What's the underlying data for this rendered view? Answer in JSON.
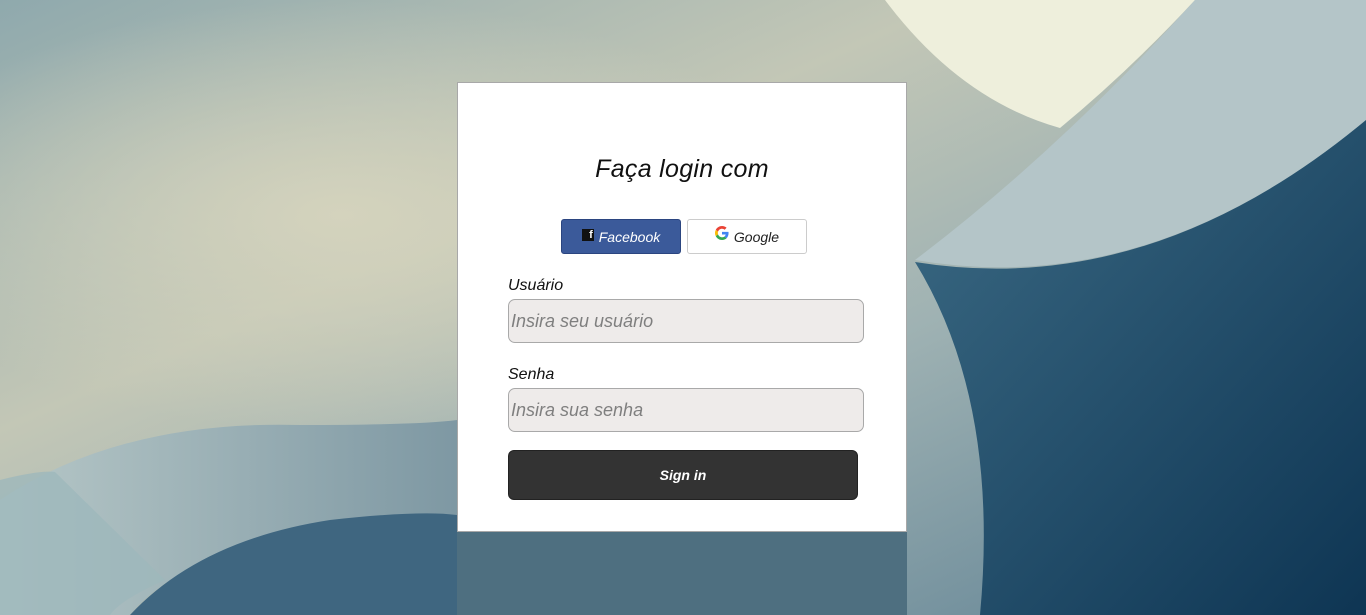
{
  "login": {
    "title": "Faça login com",
    "social": {
      "facebook_label": "Facebook",
      "google_label": "Google"
    },
    "username": {
      "label": "Usuário",
      "placeholder": "Insira seu usuário",
      "value": ""
    },
    "password": {
      "label": "Senha",
      "placeholder": "Insira sua senha",
      "value": ""
    },
    "submit_label": "Sign in"
  },
  "icons": {
    "facebook": "facebook-icon",
    "google": "google-icon"
  },
  "colors": {
    "facebook_blue": "#3b5a9a",
    "signin_button": "#333333",
    "input_background": "#eeebea",
    "card_background": "#ffffff"
  }
}
